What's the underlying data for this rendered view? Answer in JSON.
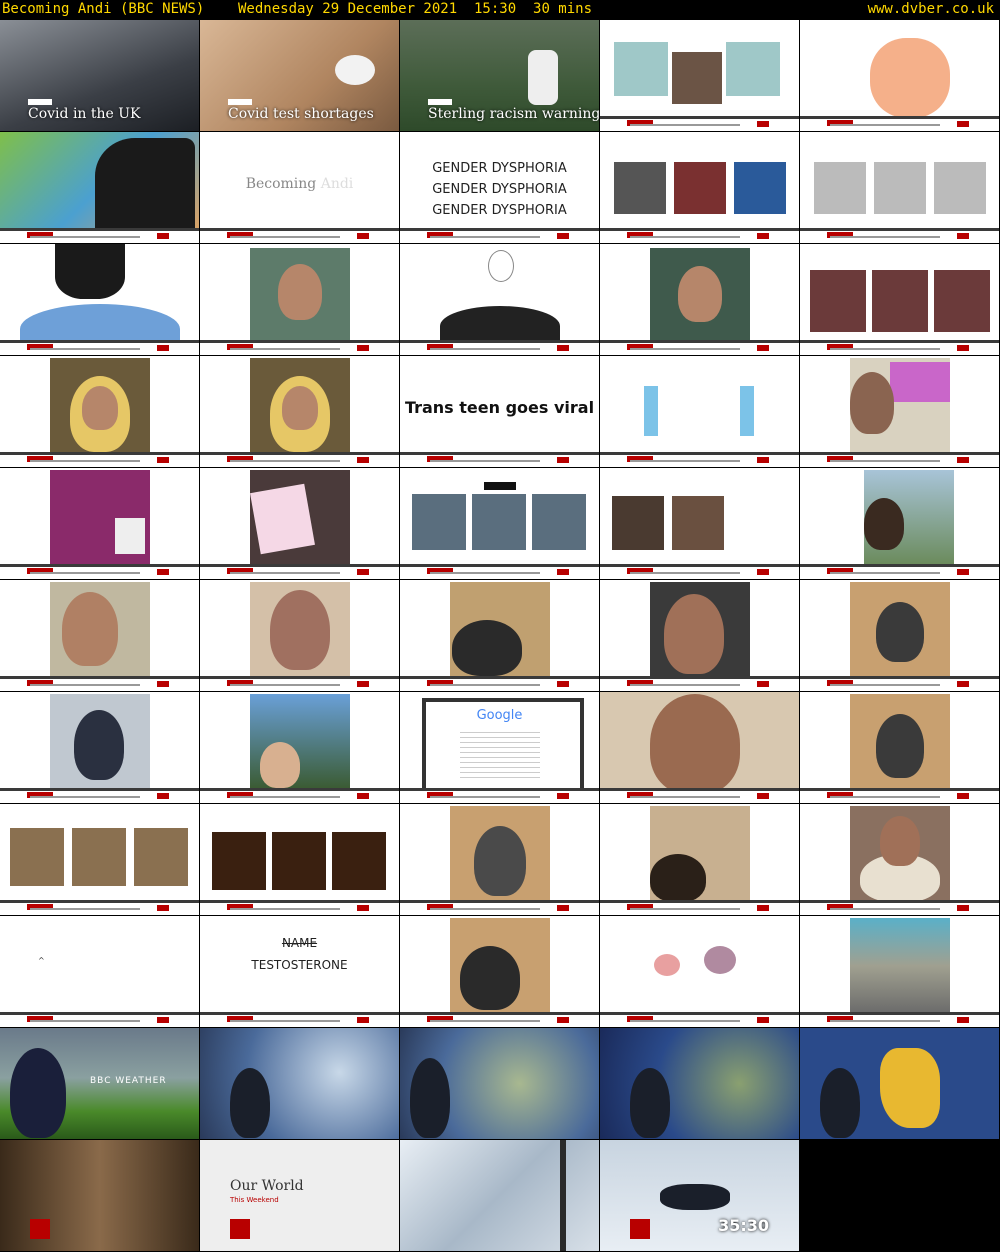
{
  "header": {
    "left_text": "Becoming Andi (BBC NEWS)    Wednesday 29 December 2021  15:30  30 mins",
    "site": "www.dvber.co.uk"
  },
  "colors": {
    "header_text": "#ffd800",
    "bbc_red": "#b80000",
    "background": "#000000"
  },
  "tiles": {
    "t1": {
      "caption": "Covid in the UK"
    },
    "t2": {
      "caption": "Covid test shortages"
    },
    "t3": {
      "caption": "Sterling racism warning"
    },
    "t7": {
      "title_a": "Becoming ",
      "title_b": "Andi"
    },
    "t8": {
      "lines": [
        "GENDER DYSPHORIA",
        "GENDER DYSPHORIA",
        "GENDER DYSPHORIA"
      ]
    },
    "t18": {
      "headline": "Trans teen goes viral"
    },
    "t33": {
      "search_logo": "Google"
    },
    "t42": {
      "struck": "NAME",
      "word": "TESTOSTERONE"
    },
    "t46": {
      "brand": "BBC WEATHER"
    },
    "t52": {
      "title": "Our World",
      "subtitle": "This Weekend"
    },
    "t54": {
      "countdown": "35:30"
    }
  }
}
